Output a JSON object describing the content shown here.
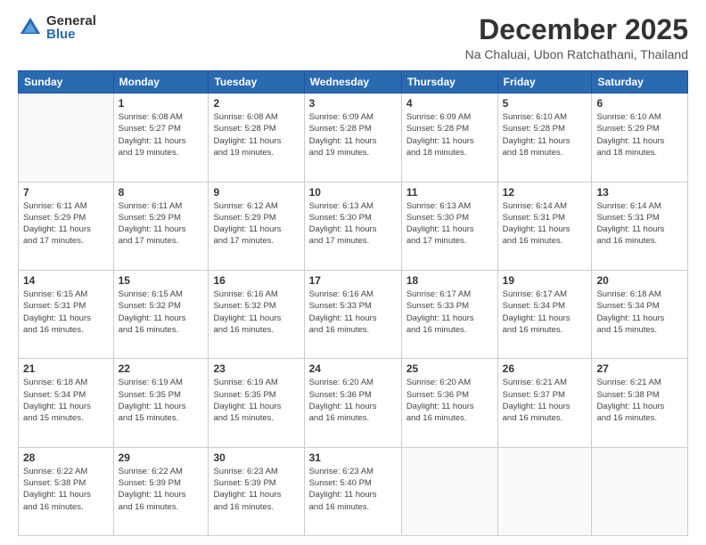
{
  "logo": {
    "general": "General",
    "blue": "Blue"
  },
  "title": "December 2025",
  "location": "Na Chaluai, Ubon Ratchathani, Thailand",
  "headers": [
    "Sunday",
    "Monday",
    "Tuesday",
    "Wednesday",
    "Thursday",
    "Friday",
    "Saturday"
  ],
  "weeks": [
    [
      {
        "day": "",
        "info": ""
      },
      {
        "day": "1",
        "info": "Sunrise: 6:08 AM\nSunset: 5:27 PM\nDaylight: 11 hours\nand 19 minutes."
      },
      {
        "day": "2",
        "info": "Sunrise: 6:08 AM\nSunset: 5:28 PM\nDaylight: 11 hours\nand 19 minutes."
      },
      {
        "day": "3",
        "info": "Sunrise: 6:09 AM\nSunset: 5:28 PM\nDaylight: 11 hours\nand 19 minutes."
      },
      {
        "day": "4",
        "info": "Sunrise: 6:09 AM\nSunset: 5:28 PM\nDaylight: 11 hours\nand 18 minutes."
      },
      {
        "day": "5",
        "info": "Sunrise: 6:10 AM\nSunset: 5:28 PM\nDaylight: 11 hours\nand 18 minutes."
      },
      {
        "day": "6",
        "info": "Sunrise: 6:10 AM\nSunset: 5:29 PM\nDaylight: 11 hours\nand 18 minutes."
      }
    ],
    [
      {
        "day": "7",
        "info": "Sunrise: 6:11 AM\nSunset: 5:29 PM\nDaylight: 11 hours\nand 17 minutes."
      },
      {
        "day": "8",
        "info": "Sunrise: 6:11 AM\nSunset: 5:29 PM\nDaylight: 11 hours\nand 17 minutes."
      },
      {
        "day": "9",
        "info": "Sunrise: 6:12 AM\nSunset: 5:29 PM\nDaylight: 11 hours\nand 17 minutes."
      },
      {
        "day": "10",
        "info": "Sunrise: 6:13 AM\nSunset: 5:30 PM\nDaylight: 11 hours\nand 17 minutes."
      },
      {
        "day": "11",
        "info": "Sunrise: 6:13 AM\nSunset: 5:30 PM\nDaylight: 11 hours\nand 17 minutes."
      },
      {
        "day": "12",
        "info": "Sunrise: 6:14 AM\nSunset: 5:31 PM\nDaylight: 11 hours\nand 16 minutes."
      },
      {
        "day": "13",
        "info": "Sunrise: 6:14 AM\nSunset: 5:31 PM\nDaylight: 11 hours\nand 16 minutes."
      }
    ],
    [
      {
        "day": "14",
        "info": "Sunrise: 6:15 AM\nSunset: 5:31 PM\nDaylight: 11 hours\nand 16 minutes."
      },
      {
        "day": "15",
        "info": "Sunrise: 6:15 AM\nSunset: 5:32 PM\nDaylight: 11 hours\nand 16 minutes."
      },
      {
        "day": "16",
        "info": "Sunrise: 6:16 AM\nSunset: 5:32 PM\nDaylight: 11 hours\nand 16 minutes."
      },
      {
        "day": "17",
        "info": "Sunrise: 6:16 AM\nSunset: 5:33 PM\nDaylight: 11 hours\nand 16 minutes."
      },
      {
        "day": "18",
        "info": "Sunrise: 6:17 AM\nSunset: 5:33 PM\nDaylight: 11 hours\nand 16 minutes."
      },
      {
        "day": "19",
        "info": "Sunrise: 6:17 AM\nSunset: 5:34 PM\nDaylight: 11 hours\nand 16 minutes."
      },
      {
        "day": "20",
        "info": "Sunrise: 6:18 AM\nSunset: 5:34 PM\nDaylight: 11 hours\nand 15 minutes."
      }
    ],
    [
      {
        "day": "21",
        "info": "Sunrise: 6:18 AM\nSunset: 5:34 PM\nDaylight: 11 hours\nand 15 minutes."
      },
      {
        "day": "22",
        "info": "Sunrise: 6:19 AM\nSunset: 5:35 PM\nDaylight: 11 hours\nand 15 minutes."
      },
      {
        "day": "23",
        "info": "Sunrise: 6:19 AM\nSunset: 5:35 PM\nDaylight: 11 hours\nand 15 minutes."
      },
      {
        "day": "24",
        "info": "Sunrise: 6:20 AM\nSunset: 5:36 PM\nDaylight: 11 hours\nand 16 minutes."
      },
      {
        "day": "25",
        "info": "Sunrise: 6:20 AM\nSunset: 5:36 PM\nDaylight: 11 hours\nand 16 minutes."
      },
      {
        "day": "26",
        "info": "Sunrise: 6:21 AM\nSunset: 5:37 PM\nDaylight: 11 hours\nand 16 minutes."
      },
      {
        "day": "27",
        "info": "Sunrise: 6:21 AM\nSunset: 5:38 PM\nDaylight: 11 hours\nand 16 minutes."
      }
    ],
    [
      {
        "day": "28",
        "info": "Sunrise: 6:22 AM\nSunset: 5:38 PM\nDaylight: 11 hours\nand 16 minutes."
      },
      {
        "day": "29",
        "info": "Sunrise: 6:22 AM\nSunset: 5:39 PM\nDaylight: 11 hours\nand 16 minutes."
      },
      {
        "day": "30",
        "info": "Sunrise: 6:23 AM\nSunset: 5:39 PM\nDaylight: 11 hours\nand 16 minutes."
      },
      {
        "day": "31",
        "info": "Sunrise: 6:23 AM\nSunset: 5:40 PM\nDaylight: 11 hours\nand 16 minutes."
      },
      {
        "day": "",
        "info": ""
      },
      {
        "day": "",
        "info": ""
      },
      {
        "day": "",
        "info": ""
      }
    ]
  ]
}
